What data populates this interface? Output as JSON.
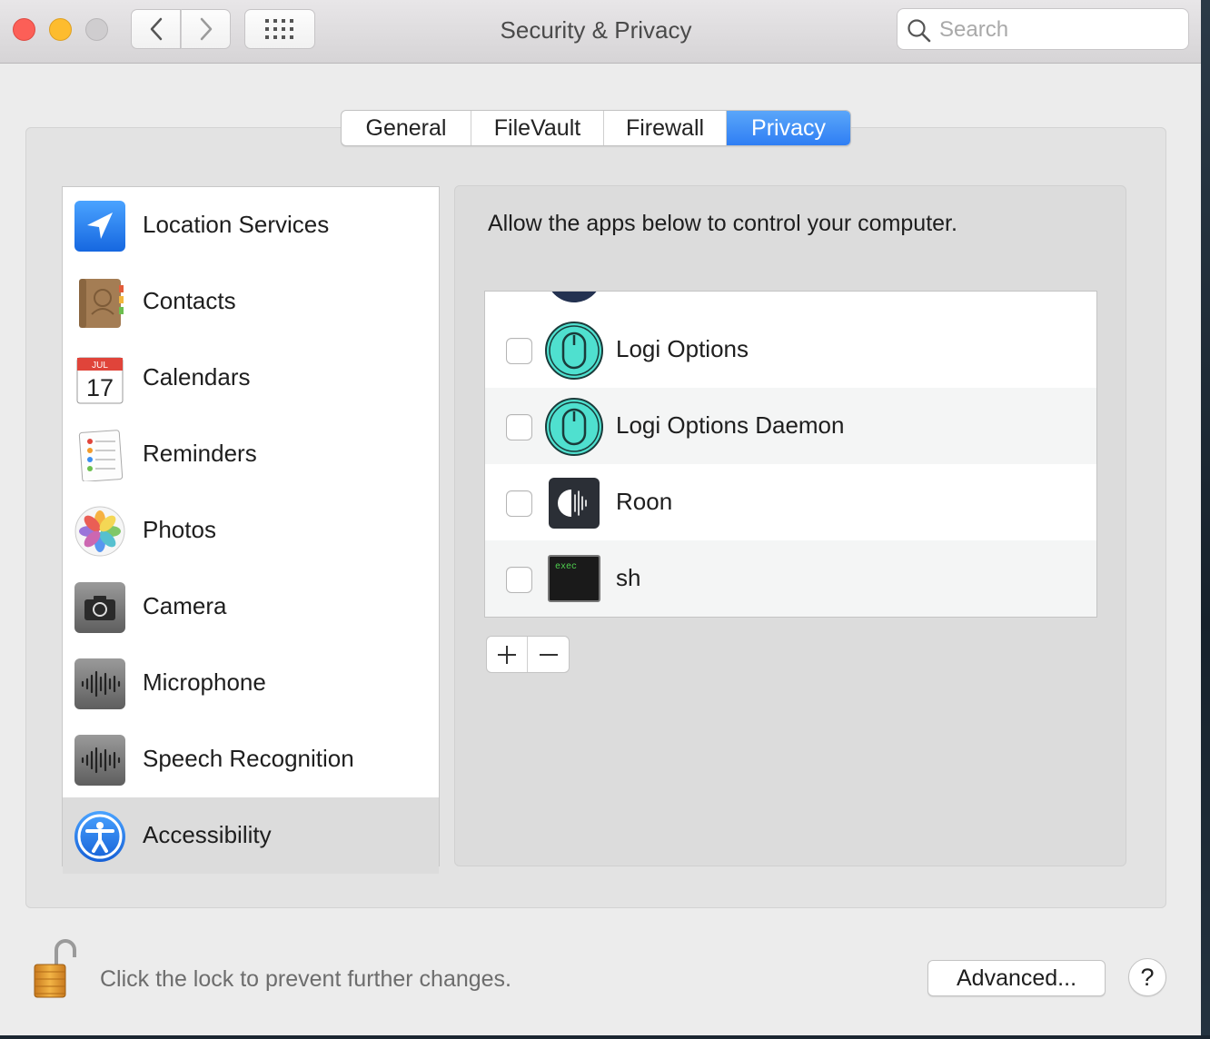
{
  "window": {
    "title": "Security & Privacy",
    "search_placeholder": "Search"
  },
  "tabs": [
    {
      "label": "General",
      "selected": false
    },
    {
      "label": "FileVault",
      "selected": false
    },
    {
      "label": "Firewall",
      "selected": false
    },
    {
      "label": "Privacy",
      "selected": true
    }
  ],
  "categories": [
    {
      "label": "Location Services",
      "icon": "location-arrow-icon",
      "selected": false
    },
    {
      "label": "Contacts",
      "icon": "contacts-book-icon",
      "selected": false
    },
    {
      "label": "Calendars",
      "icon": "calendar-icon",
      "selected": false,
      "icon_month": "JUL",
      "icon_day": "17"
    },
    {
      "label": "Reminders",
      "icon": "reminders-list-icon",
      "selected": false
    },
    {
      "label": "Photos",
      "icon": "photos-flower-icon",
      "selected": false
    },
    {
      "label": "Camera",
      "icon": "camera-icon",
      "selected": false
    },
    {
      "label": "Microphone",
      "icon": "microphone-waveform-icon",
      "selected": false
    },
    {
      "label": "Speech Recognition",
      "icon": "speech-waveform-icon",
      "selected": false
    },
    {
      "label": "Accessibility",
      "icon": "accessibility-icon",
      "selected": true
    }
  ],
  "panel": {
    "description": "Allow the apps below to control your computer."
  },
  "apps": [
    {
      "label": "Logi Options",
      "icon": "logi-mouse-icon",
      "checked": false
    },
    {
      "label": "Logi Options Daemon",
      "icon": "logi-mouse-icon",
      "checked": false
    },
    {
      "label": "Roon",
      "icon": "roon-icon",
      "checked": false
    },
    {
      "label": "sh",
      "icon": "terminal-exec-icon",
      "checked": false,
      "icon_text": "exec"
    }
  ],
  "list_controls": {
    "add": "+",
    "remove": "−"
  },
  "footer": {
    "lock_message": "Click the lock to prevent further changes.",
    "advanced_label": "Advanced...",
    "help_label": "?"
  },
  "colors": {
    "accent": "#2f7ef4",
    "selected_row": "#dcdcdc",
    "logi_teal": "#4fe0cf"
  }
}
